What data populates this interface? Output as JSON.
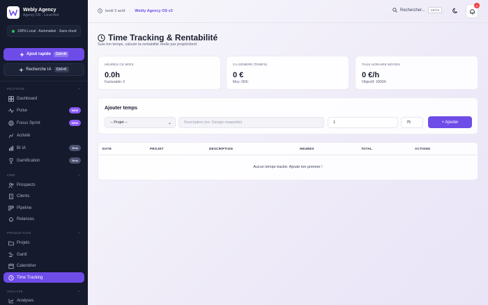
{
  "brand": {
    "name": "Webly Agency",
    "subtitle": "Agency OS · Local-first"
  },
  "status": {
    "text": "100% Local · Automatisé · Sans cloud"
  },
  "quick_add": {
    "label": "Ajout rapide",
    "shortcut": "Ctrl+N"
  },
  "ai_search": {
    "label": "Recherche IA",
    "shortcut": "Ctrl+K"
  },
  "sidebar": {
    "sections": [
      {
        "label": "PILOTAGE"
      },
      {
        "label": "CRM"
      },
      {
        "label": "PRODUCTION"
      },
      {
        "label": "ANALYSE"
      }
    ],
    "items": [
      {
        "label": "Dashboard",
        "icon": "grid-icon"
      },
      {
        "label": "Pulse",
        "icon": "pulse-icon",
        "badge": "NEW"
      },
      {
        "label": "Focus Sprint",
        "icon": "target-icon",
        "badge": "NEW"
      },
      {
        "label": "Activité",
        "icon": "activity-icon"
      },
      {
        "label": "BI IA",
        "icon": "chart-icon",
        "badge": "Bêta"
      },
      {
        "label": "Gamification",
        "icon": "trophy-icon",
        "badge": "Bêta"
      },
      {
        "label": "Prospects",
        "icon": "users-icon"
      },
      {
        "label": "Clients",
        "icon": "building-icon"
      },
      {
        "label": "Pipeline",
        "icon": "pipeline-icon"
      },
      {
        "label": "Relances",
        "icon": "bell-icon"
      },
      {
        "label": "Projets",
        "icon": "folder-icon"
      },
      {
        "label": "Gantt",
        "icon": "gantt-icon"
      },
      {
        "label": "Calendrier",
        "icon": "calendar-icon"
      },
      {
        "label": "Time Tracking",
        "icon": "clock-icon",
        "active": true
      },
      {
        "label": "Analyses",
        "icon": "analytics-icon"
      }
    ]
  },
  "topbar": {
    "date": "lundi 3 août",
    "app_version": "Webly Agency OS v3",
    "search_label": "Rechercher...",
    "search_shortcut": "Ctrl+K",
    "notifications": "5"
  },
  "page": {
    "title": "Time Tracking & Rentabilité",
    "subtitle": "Suis ton temps, calcule ta rentabilité réelle par projet/client"
  },
  "stats": [
    {
      "label": "HEURES CE MOIS",
      "value": "0.0h",
      "sub": "Facturable: 0"
    },
    {
      "label": "CA GÉNÉRÉ (TEMPS)",
      "value": "0 €",
      "sub": "Moy: 0€/h"
    },
    {
      "label": "TAUX HORAIRE MOYEN",
      "value": "0 €/h",
      "sub": "Objectif: 100€/h"
    }
  ],
  "add_form": {
    "title": "Ajouter temps",
    "project_selected": "-- Projet --",
    "description_placeholder": "Description (ex: Design maquette)",
    "hours_value": "1",
    "rate_value": "75",
    "submit_label": "+ Ajouter"
  },
  "table": {
    "headers": [
      "DATE",
      "PROJET",
      "DESCRIPTION",
      "HEURES",
      "TOTAL",
      "ACTIONS"
    ],
    "empty_text": "Aucun temps tracké. Ajoute ton premier !"
  },
  "colors": {
    "accent": "#6d4ce8",
    "sidebar_bg": "#151a2c",
    "success": "#22c55e"
  }
}
